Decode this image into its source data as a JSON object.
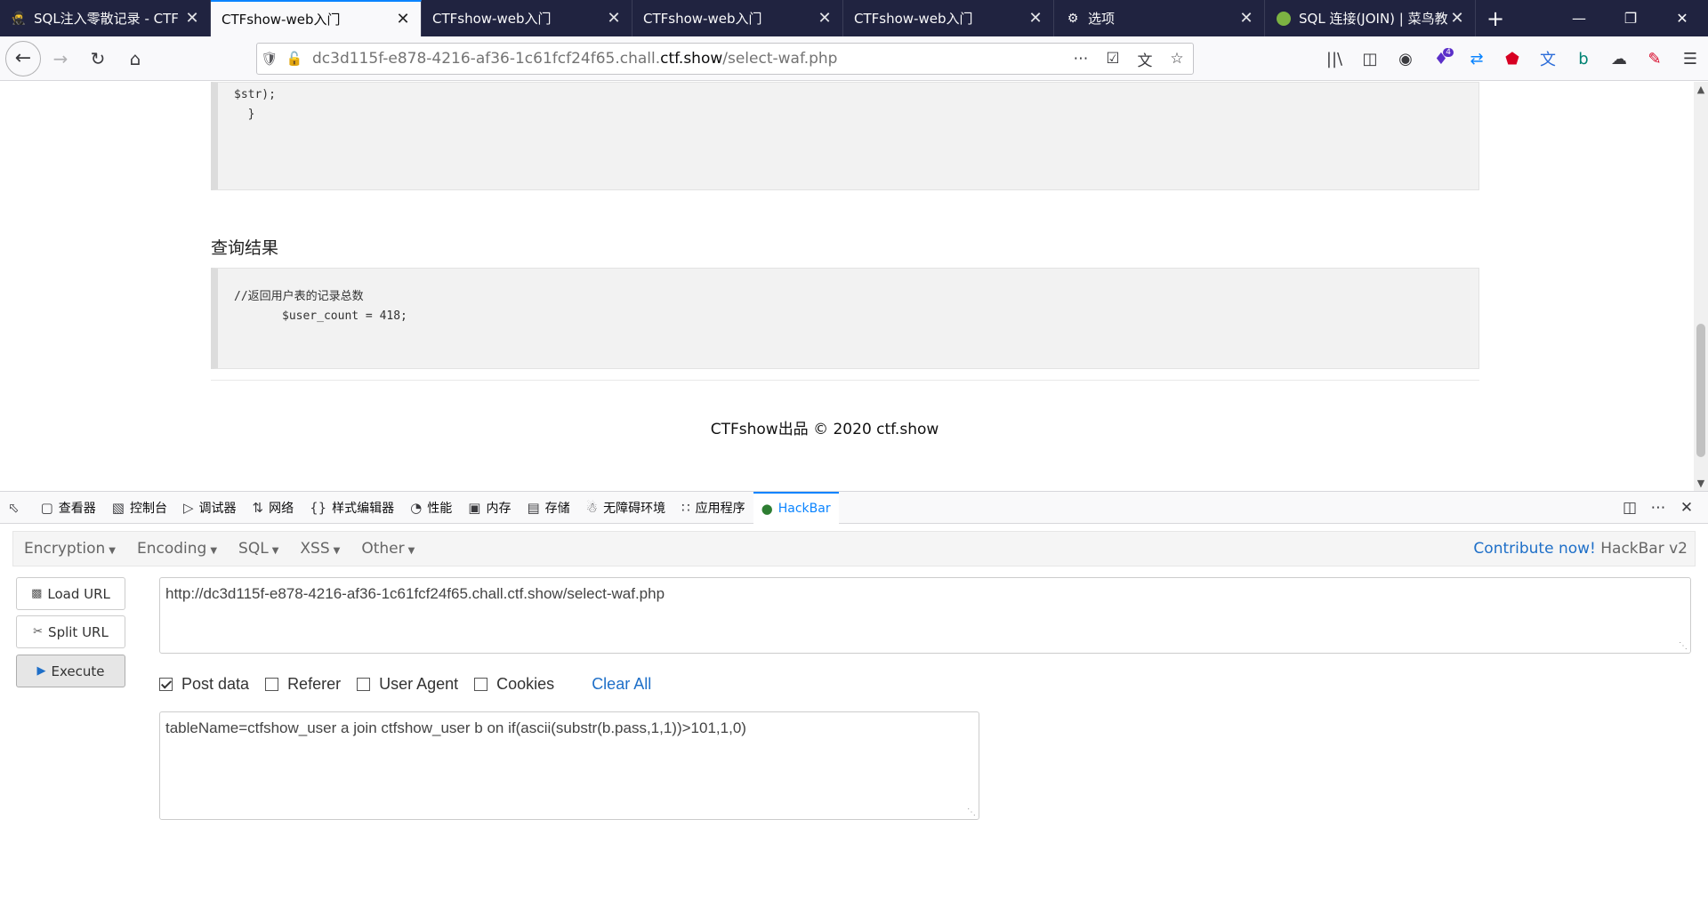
{
  "browser": {
    "tabs": [
      {
        "title": "SQL注入零散记录 - CTF",
        "icon": "ninja-icon",
        "active": false
      },
      {
        "title": "CTFshow-web入门",
        "icon": "",
        "active": true
      },
      {
        "title": "CTFshow-web入门",
        "icon": "",
        "active": false
      },
      {
        "title": "CTFshow-web入门",
        "icon": "",
        "active": false
      },
      {
        "title": "CTFshow-web入门",
        "icon": "",
        "active": false
      },
      {
        "title": "选项",
        "icon": "gear-icon",
        "active": false
      },
      {
        "title": "SQL 连接(JOIN) | 菜鸟教",
        "icon": "runoob-icon",
        "active": false
      }
    ],
    "url_prefix": "dc3d115f-e878-4216-af36-1c61fcf24f65.chall.",
    "url_domain": "ctf.show",
    "url_path": "/select-waf.php",
    "extension_badge": "4"
  },
  "page": {
    "code_top_lines": [
      "$str);",
      "  }"
    ],
    "section_title": "查询结果",
    "result_comment": "//返回用户表的记录总数",
    "result_line": "$user_count = 418;",
    "footer_brand": "CTFshow出品 © 2020 ",
    "footer_link": "ctf.show"
  },
  "devtools": {
    "tabs": [
      {
        "label": "查看器",
        "icon": "inspector-icon"
      },
      {
        "label": "控制台",
        "icon": "console-icon"
      },
      {
        "label": "调试器",
        "icon": "debugger-icon"
      },
      {
        "label": "网络",
        "icon": "network-icon"
      },
      {
        "label": "样式编辑器",
        "icon": "style-editor-icon"
      },
      {
        "label": "性能",
        "icon": "performance-icon"
      },
      {
        "label": "内存",
        "icon": "memory-icon"
      },
      {
        "label": "存储",
        "icon": "storage-icon"
      },
      {
        "label": "无障碍环境",
        "icon": "accessibility-icon"
      },
      {
        "label": "应用程序",
        "icon": "application-icon"
      },
      {
        "label": "HackBar",
        "icon": "hackbar-icon",
        "active": true
      }
    ]
  },
  "hackbar": {
    "menu": [
      "Encryption",
      "Encoding",
      "SQL",
      "XSS",
      "Other"
    ],
    "contribute_link": "Contribute now!",
    "version": "HackBar v2",
    "load_url": "Load URL",
    "split_url": "Split URL",
    "execute": "Execute",
    "url_value": "http://dc3d115f-e878-4216-af36-1c61fcf24f65.chall.ctf.show/select-waf.php",
    "options": [
      {
        "label": "Post data",
        "checked": true
      },
      {
        "label": "Referer",
        "checked": false
      },
      {
        "label": "User Agent",
        "checked": false
      },
      {
        "label": "Cookies",
        "checked": false
      }
    ],
    "clear_all": "Clear All",
    "post_value": "tableName=ctfshow_user a join ctfshow_user b on if(ascii(substr(b.pass,1,1))>101,1,0)"
  },
  "colors": {
    "accent": "#0a84ff",
    "tabstrip": "#202340",
    "link": "#1e6fc8"
  }
}
